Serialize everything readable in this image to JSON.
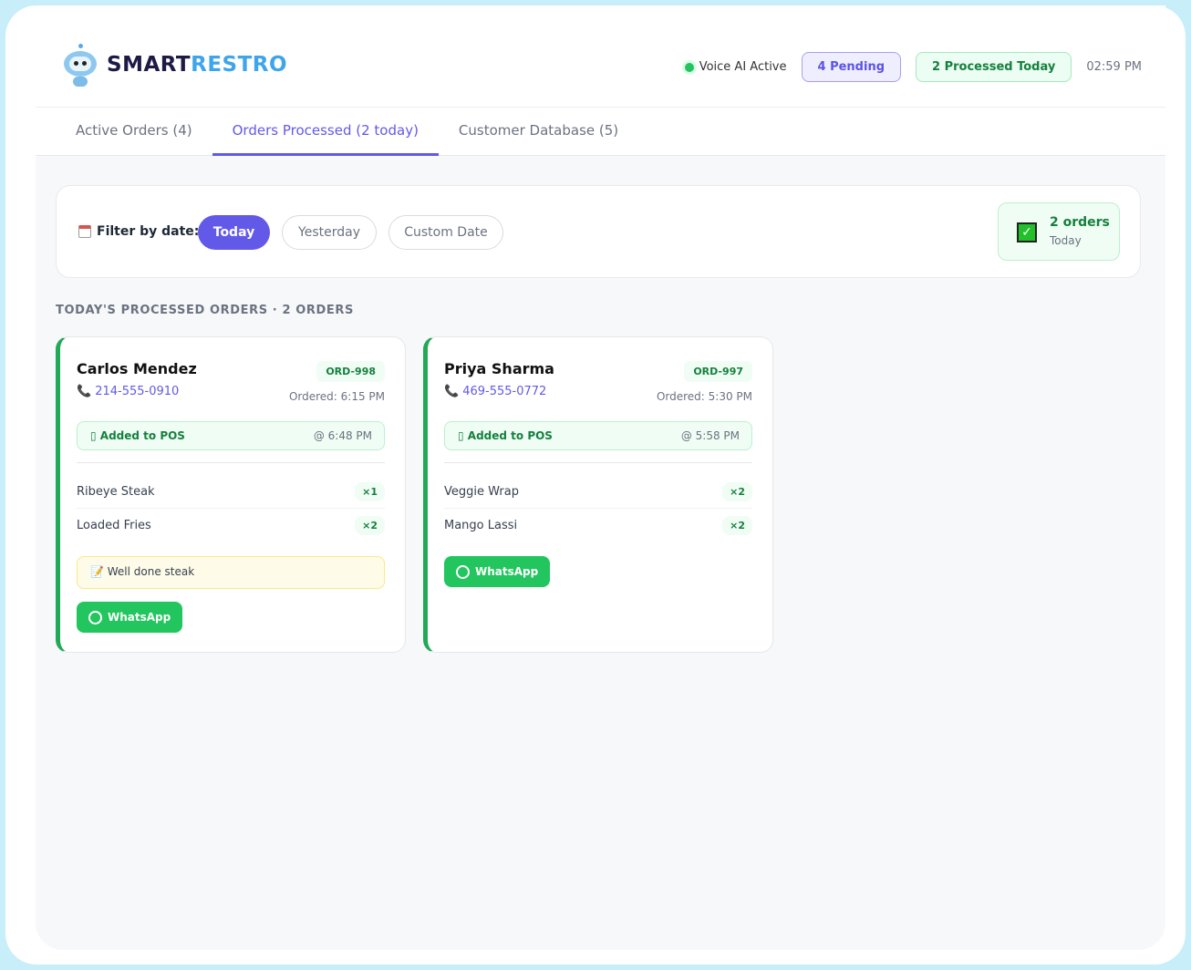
{
  "brand": {
    "part1": "SMART",
    "part2": "RESTRO"
  },
  "header": {
    "voice": "Voice AI Active",
    "pending": "4 Pending",
    "processed": "2 Processed Today",
    "time": "02:59 PM"
  },
  "tabs": [
    {
      "label": "Active Orders (4)"
    },
    {
      "label": "Orders Processed (2 today)"
    },
    {
      "label": "Customer Database (5)"
    }
  ],
  "filter": {
    "label": "Filter by date:",
    "options": [
      "Today",
      "Yesterday",
      "Custom Date"
    ],
    "summary_count": "2 orders",
    "summary_period": "Today"
  },
  "section_title": "TODAY'S PROCESSED ORDERS · 2 ORDERS",
  "orders": [
    {
      "name": "Carlos Mendez",
      "phone": "214-555-0910",
      "id": "ORD-998",
      "ordered": "Ordered: 6:15 PM",
      "pos": "Added to POS",
      "pos_time": "@ 6:48 PM",
      "items": [
        {
          "name": "Ribeye Steak",
          "qty": "×1"
        },
        {
          "name": "Loaded Fries",
          "qty": "×2"
        }
      ],
      "note": "Well done steak",
      "whatsapp": "WhatsApp"
    },
    {
      "name": "Priya Sharma",
      "phone": "469-555-0772",
      "id": "ORD-997",
      "ordered": "Ordered: 5:30 PM",
      "pos": "Added to POS",
      "pos_time": "@ 5:58 PM",
      "items": [
        {
          "name": "Veggie Wrap",
          "qty": "×2"
        },
        {
          "name": "Mango Lassi",
          "qty": "×2"
        }
      ],
      "whatsapp": "WhatsApp"
    }
  ]
}
